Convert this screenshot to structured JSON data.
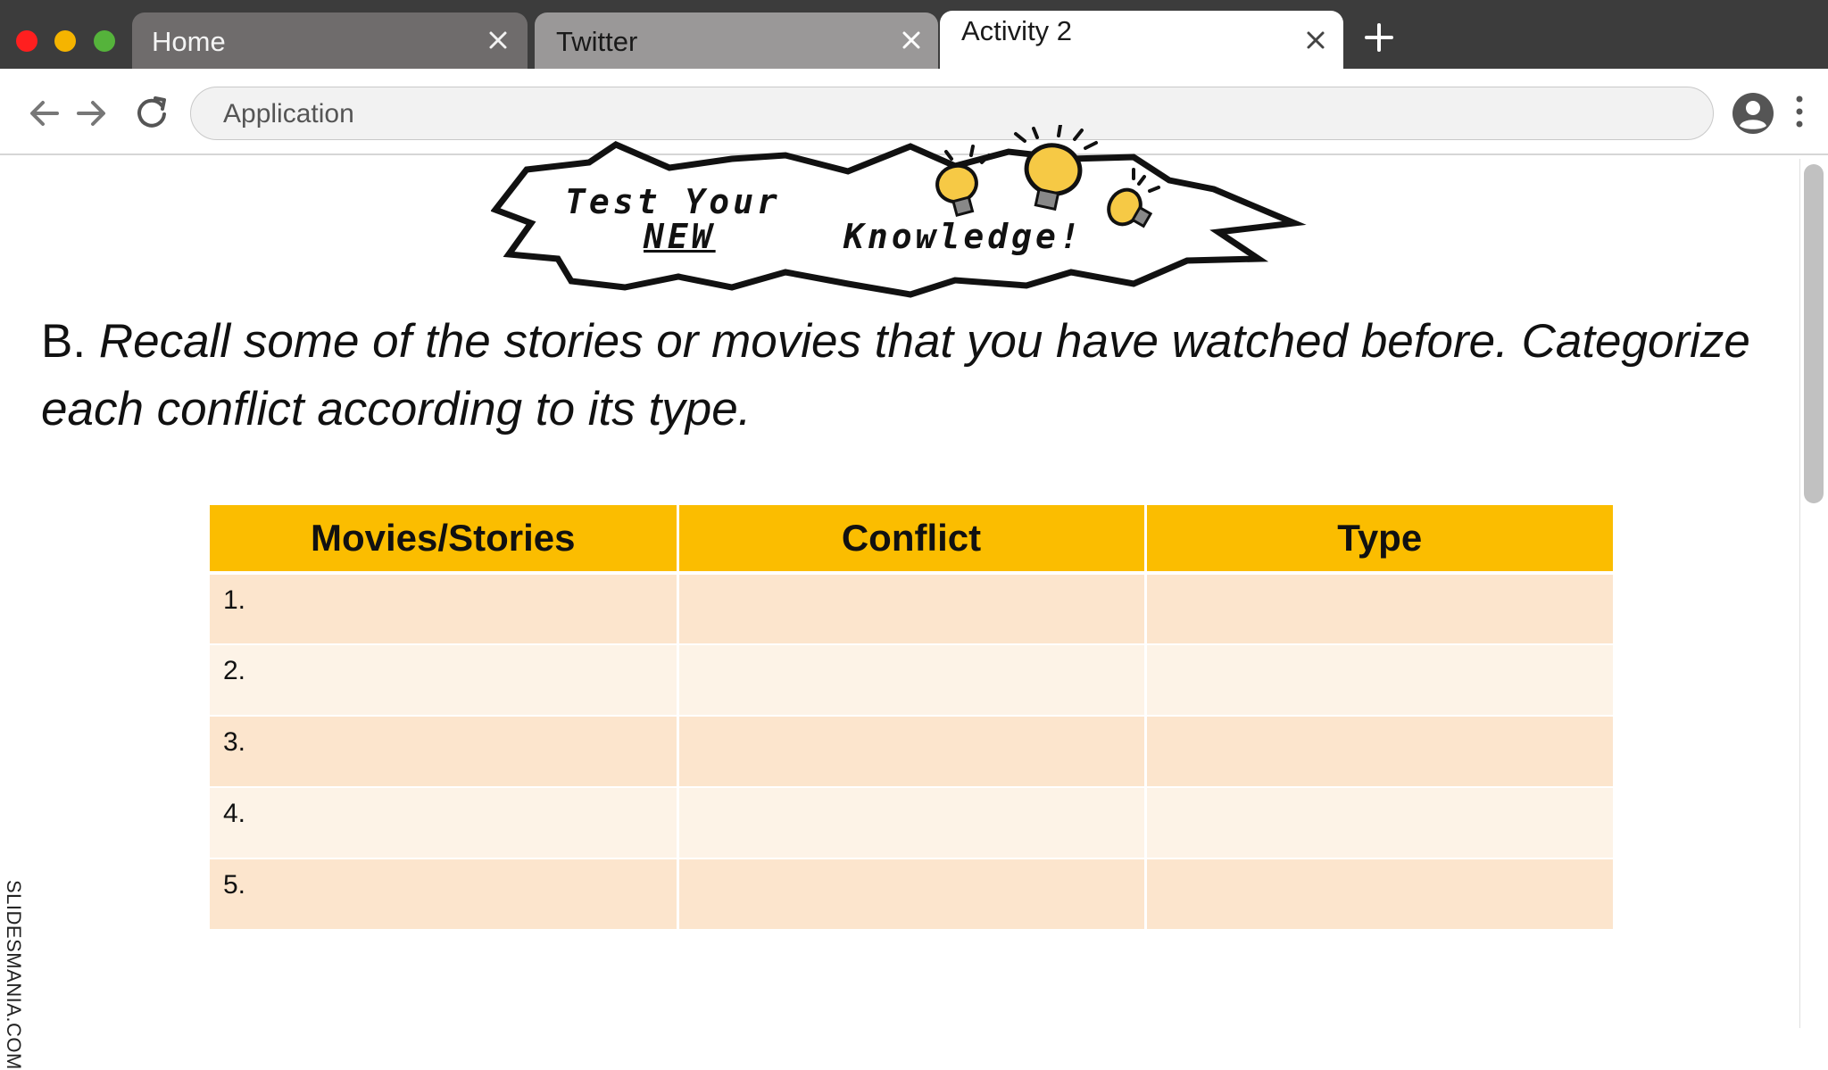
{
  "window": {
    "controls": {
      "close_color": "#ff1f1f",
      "minimize_color": "#f5b400",
      "maximize_color": "#55b33b"
    }
  },
  "tabs": [
    {
      "title": "Home",
      "active": false
    },
    {
      "title": "Twitter",
      "active": false
    },
    {
      "title": "Activity 2",
      "active": true
    }
  ],
  "toolbar": {
    "back_icon": "arrow-left-icon",
    "forward_icon": "arrow-right-icon",
    "reload_icon": "reload-icon",
    "address_value": "Application",
    "profile_icon": "account-icon",
    "menu_icon": "kebab-menu-icon"
  },
  "content": {
    "banner": {
      "line1": "Test Your",
      "line2a": "NEW",
      "line2b": "Knowledge!",
      "icon": "lightbulb-icon"
    },
    "instruction": {
      "prefix": "B.",
      "text": "Recall some of the stories or movies that you have watched before. Categorize each conflict according to its type."
    },
    "table": {
      "headers": [
        "Movies/Stories",
        "Conflict",
        "Type"
      ],
      "rows": [
        [
          "1.",
          "",
          ""
        ],
        [
          "2.",
          "",
          ""
        ],
        [
          "3.",
          "",
          ""
        ],
        [
          "4.",
          "",
          ""
        ],
        [
          "5.",
          "",
          ""
        ]
      ]
    },
    "watermark": "SLIDESMANIA.COM"
  },
  "colors": {
    "header_bg": "#fbbd00",
    "row_odd": "#fce5cd",
    "row_even": "#fdf3e7",
    "tabstrip": "#3c3c3c"
  }
}
